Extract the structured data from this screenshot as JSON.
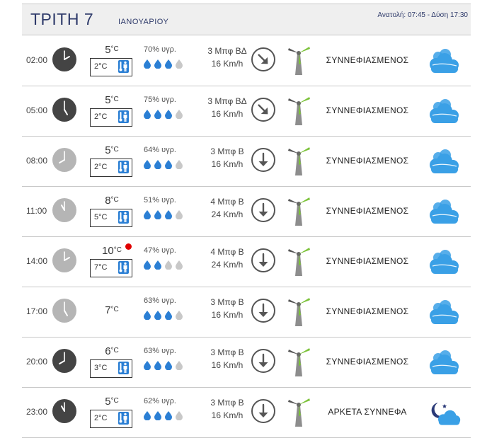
{
  "header": {
    "day_title": "ΤΡΙΤΗ 7",
    "month": "ΙΑΝΟΥΑΡΙΟΥ",
    "sun_times": "Ανατολή: 07:45 - Δύση 17:30"
  },
  "rows": [
    {
      "time": "02:00",
      "hour": 2,
      "clock_dark": true,
      "temp": "5",
      "temp_unit": "°C",
      "feels": "2°C",
      "humidity": "70% υγρ.",
      "drops_filled": 3,
      "wind_beaufort": "3 Μπφ ΒΔ",
      "wind_speed": "16 Km/h",
      "wind_dir": "NW",
      "condition": "ΣΥΝΝΕΦΙΑΣΜΕΝΟΣ",
      "icon": "cloud-icon",
      "hot": false
    },
    {
      "time": "05:00",
      "hour": 5,
      "clock_dark": true,
      "temp": "5",
      "temp_unit": "°C",
      "feels": "2°C",
      "humidity": "75% υγρ.",
      "drops_filled": 3,
      "wind_beaufort": "3 Μπφ ΒΔ",
      "wind_speed": "16 Km/h",
      "wind_dir": "NW",
      "condition": "ΣΥΝΝΕΦΙΑΣΜΕΝΟΣ",
      "icon": "cloud-icon",
      "hot": false
    },
    {
      "time": "08:00",
      "hour": 8,
      "clock_dark": false,
      "temp": "5",
      "temp_unit": "°C",
      "feels": "2°C",
      "humidity": "64% υγρ.",
      "drops_filled": 3,
      "wind_beaufort": "3 Μπφ Β",
      "wind_speed": "16 Km/h",
      "wind_dir": "N",
      "condition": "ΣΥΝΝΕΦΙΑΣΜΕΝΟΣ",
      "icon": "cloud-icon",
      "hot": false
    },
    {
      "time": "11:00",
      "hour": 11,
      "clock_dark": false,
      "temp": "8",
      "temp_unit": "°C",
      "feels": "5°C",
      "humidity": "51% υγρ.",
      "drops_filled": 3,
      "wind_beaufort": "4 Μπφ Β",
      "wind_speed": "24 Km/h",
      "wind_dir": "N",
      "condition": "ΣΥΝΝΕΦΙΑΣΜΕΝΟΣ",
      "icon": "cloud-icon",
      "hot": false
    },
    {
      "time": "14:00",
      "hour": 14,
      "clock_dark": false,
      "temp": "10",
      "temp_unit": "°C",
      "feels": "7°C",
      "humidity": "47% υγρ.",
      "drops_filled": 2,
      "wind_beaufort": "4 Μπφ Β",
      "wind_speed": "24 Km/h",
      "wind_dir": "N",
      "condition": "ΣΥΝΝΕΦΙΑΣΜΕΝΟΣ",
      "icon": "cloud-icon",
      "hot": true
    },
    {
      "time": "17:00",
      "hour": 17,
      "clock_dark": false,
      "temp": "7",
      "temp_unit": "°C",
      "feels": "",
      "humidity": "63% υγρ.",
      "drops_filled": 3,
      "wind_beaufort": "3 Μπφ Β",
      "wind_speed": "16 Km/h",
      "wind_dir": "N",
      "condition": "ΣΥΝΝΕΦΙΑΣΜΕΝΟΣ",
      "icon": "cloud-icon",
      "hot": false
    },
    {
      "time": "20:00",
      "hour": 20,
      "clock_dark": true,
      "temp": "6",
      "temp_unit": "°C",
      "feels": "3°C",
      "humidity": "63% υγρ.",
      "drops_filled": 3,
      "wind_beaufort": "3 Μπφ Β",
      "wind_speed": "16 Km/h",
      "wind_dir": "N",
      "condition": "ΣΥΝΝΕΦΙΑΣΜΕΝΟΣ",
      "icon": "cloud-icon",
      "hot": false
    },
    {
      "time": "23:00",
      "hour": 23,
      "clock_dark": true,
      "temp": "5",
      "temp_unit": "°C",
      "feels": "2°C",
      "humidity": "62% υγρ.",
      "drops_filled": 3,
      "wind_beaufort": "3 Μπφ Β",
      "wind_speed": "16 Km/h",
      "wind_dir": "N",
      "condition": "ΑΡΚΕΤΑ ΣΥΝΝΕΦΑ",
      "icon": "moon-cloud-icon",
      "hot": false
    }
  ],
  "colors": {
    "title": "#2e3a6a",
    "clock_dark": "#444444",
    "clock_light": "#b5b5b5",
    "drop_filled": "#2b7fd4",
    "drop_empty": "#c8c8c8",
    "cloud": "#3aa0e6",
    "turbine_blade": "#7cc23a",
    "hot_dot": "#e00000"
  }
}
